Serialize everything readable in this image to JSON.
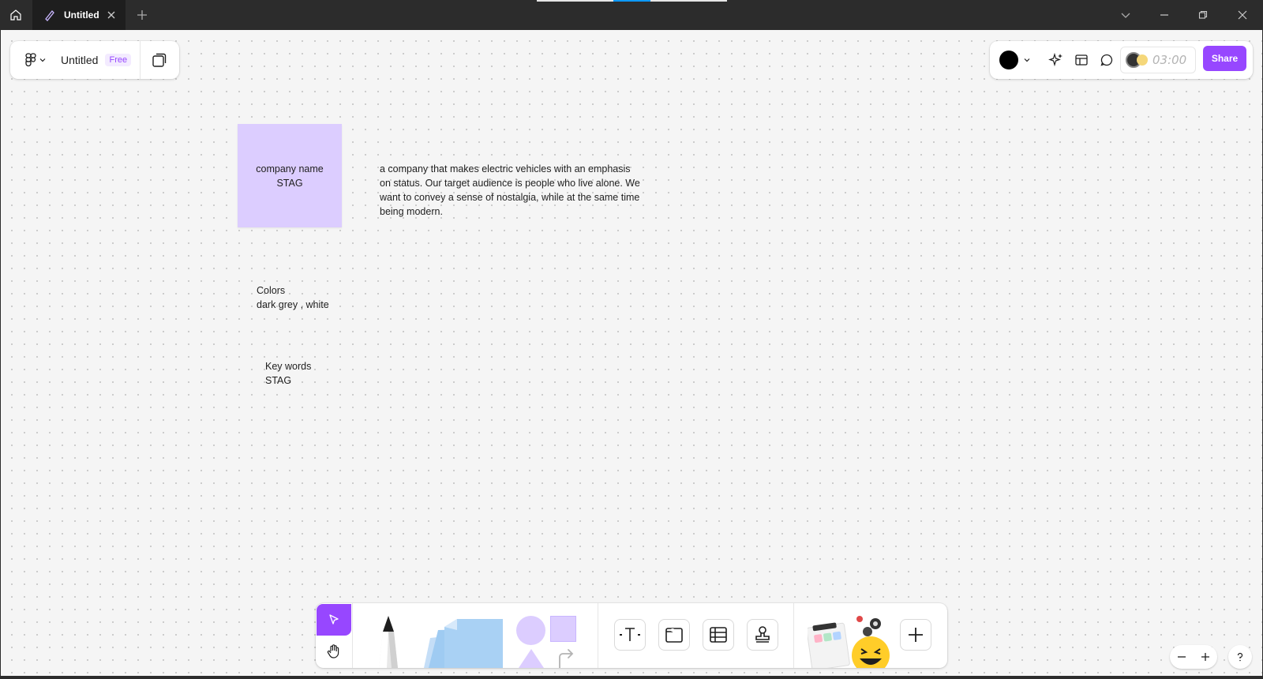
{
  "window": {
    "tab_title": "Untitled"
  },
  "file_panel": {
    "title": "Untitled",
    "plan_badge": "Free"
  },
  "right_panel": {
    "color": "#000000",
    "timer": "03:00",
    "share_label": "Share"
  },
  "board": {
    "sticky": {
      "line1": "company name",
      "line2": "STAG",
      "color": "#dccdff"
    },
    "description": {
      "line1": "a company that makes electric vehicles with an emphasis",
      "line2": "on status. Our target audience is people who live alone. We",
      "line3": "want to convey a sense of nostalgia, while at the same time",
      "line4": "being modern."
    },
    "colors_note": {
      "line1": "Colors",
      "line2": "dark grey , white"
    },
    "keywords_note": {
      "line1": "Key words",
      "line2": "STAG"
    }
  },
  "toolbar": {
    "tools": [
      "select-tool",
      "hand-tool",
      "pen-tool",
      "sticky-note-tool",
      "shape-tool",
      "text-tool",
      "section-tool",
      "table-tool",
      "stamp-tool",
      "widgets-tool",
      "more-tool"
    ]
  },
  "theme": {
    "accent": "#9747ff",
    "canvas_bg": "#f5f5f5",
    "titlebar_bg": "#2c2c2c"
  }
}
